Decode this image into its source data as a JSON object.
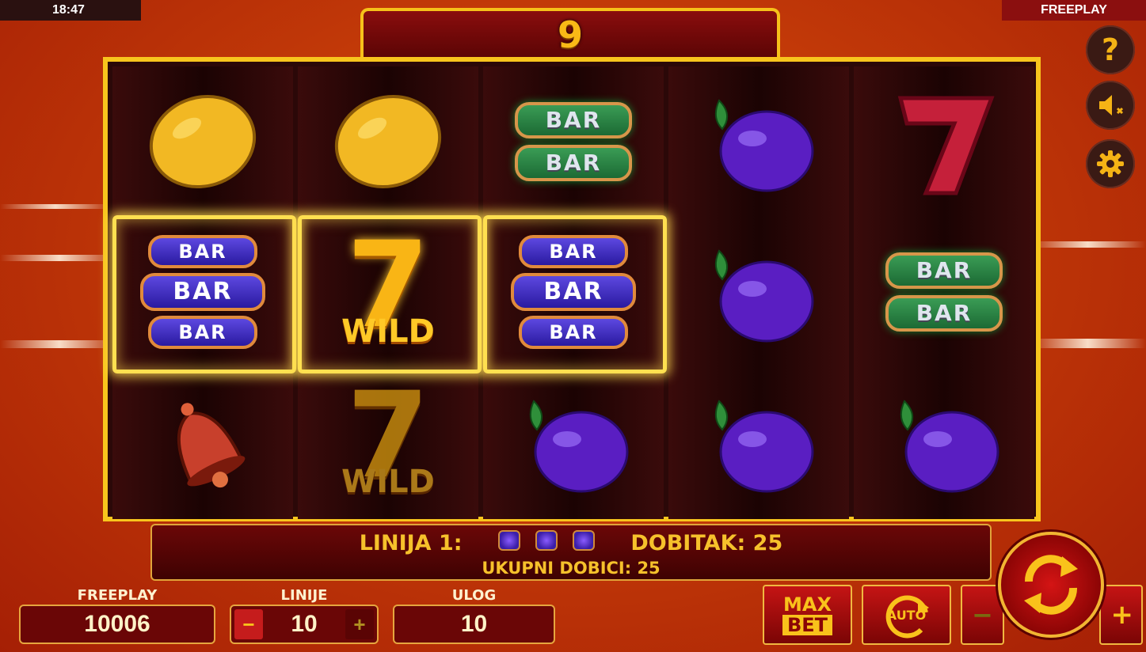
{
  "status": {
    "time": "18:47",
    "mode": "FREEPLAY"
  },
  "counter": {
    "value": "9"
  },
  "side": {
    "help_icon": "?",
    "sound_icon": "speaker-muted",
    "settings_icon": "gear"
  },
  "reels": [
    [
      "lemon",
      "bar-triple-purple",
      "bell"
    ],
    [
      "lemon",
      "seven-wild",
      "seven-wild"
    ],
    [
      "bar-double-green",
      "bar-triple-purple",
      "plum"
    ],
    [
      "plum",
      "plum",
      "plum"
    ],
    [
      "seven-red",
      "bar-double-green",
      "plum"
    ]
  ],
  "symbols": {
    "bar": "BAR",
    "wild": "WILD",
    "seven": "7"
  },
  "win_info": {
    "line_label": "LINIJA 1:",
    "win_label": "DOBITAK: 25",
    "total_label": "UKUPNI DOBICI: 25"
  },
  "controls": {
    "freeplay_label": "FREEPLAY",
    "freeplay_value": "10006",
    "lines_label": "LINIJE",
    "lines_value": "10",
    "lines_minus": "−",
    "lines_plus": "+",
    "bet_label": "ULOG",
    "bet_value": "10",
    "maxbet_top": "MAX",
    "maxbet_bottom": "BET",
    "auto_label": "AUTO",
    "bet_minus": "−",
    "bet_plus": "+"
  },
  "colors": {
    "frame": "#f8c51d",
    "accent": "#f6c12b",
    "board_bg": "#2b0808"
  }
}
